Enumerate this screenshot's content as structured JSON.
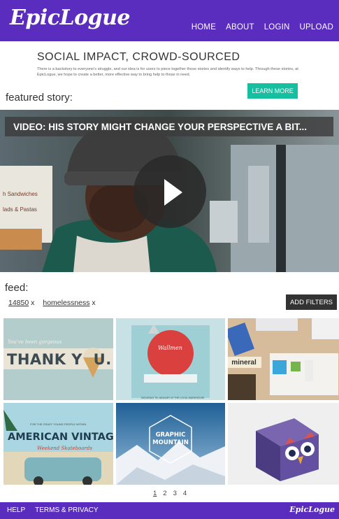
{
  "brand": {
    "logo": "EpicLogue"
  },
  "nav": [
    "HOME",
    "ABOUT",
    "LOGIN",
    "UPLOAD"
  ],
  "intro": {
    "title": "SOCIAL IMPACT, CROWD-SOURCED",
    "text": "There is a backstory to everyone's struggle, and our idea is for users to piece together those stories and identify ways to help. Through these stories, at EpicLogue, we hope to create a better, more effective way to bring help to those in need.",
    "button": "LEARN MORE"
  },
  "featured": {
    "label": "featured story:",
    "video_title": "VIDEO: HIS STORY MIGHT CHANGE YOUR PERSPECTIVE A BIT...",
    "shop_sign_1": "h Sandwiches",
    "shop_sign_2": "lads & Pastas"
  },
  "feed": {
    "label": "feed:",
    "tags": [
      {
        "text": "14850",
        "remove": "x"
      },
      {
        "text": "homelessness",
        "remove": "x"
      }
    ],
    "filters_button": "ADD FILTERS",
    "tiles": [
      {
        "name": "thank-you",
        "line1": "You've been gorgeous",
        "line2": "THANK Y  U."
      },
      {
        "name": "wallmen",
        "label": "Wallmen",
        "caption": "SATURDAY 7th JANUARY AT THE LOCAL WAREHOUSE"
      },
      {
        "name": "mineral",
        "label": "mineral"
      },
      {
        "name": "american-vintage",
        "tagline": "FOR THE CRAZY YOUNG PEOPLE WITHIN",
        "line1": "AMERICAN VINTAGE",
        "line2": "Weekend Skateboards"
      },
      {
        "name": "graphic-mountain",
        "line1": "GRAPHIC",
        "line2": "MOUNTAIN"
      },
      {
        "name": "owl-cube"
      }
    ]
  },
  "pagination": [
    "1",
    "2",
    "3",
    "4"
  ],
  "footer": {
    "links": [
      "HELP",
      "TERMS & PRIVACY"
    ],
    "logo": "EpicLogue"
  },
  "colors": {
    "brand_purple": "#5a2dbf",
    "teal": "#16bfa0",
    "dark_button": "#333333"
  }
}
